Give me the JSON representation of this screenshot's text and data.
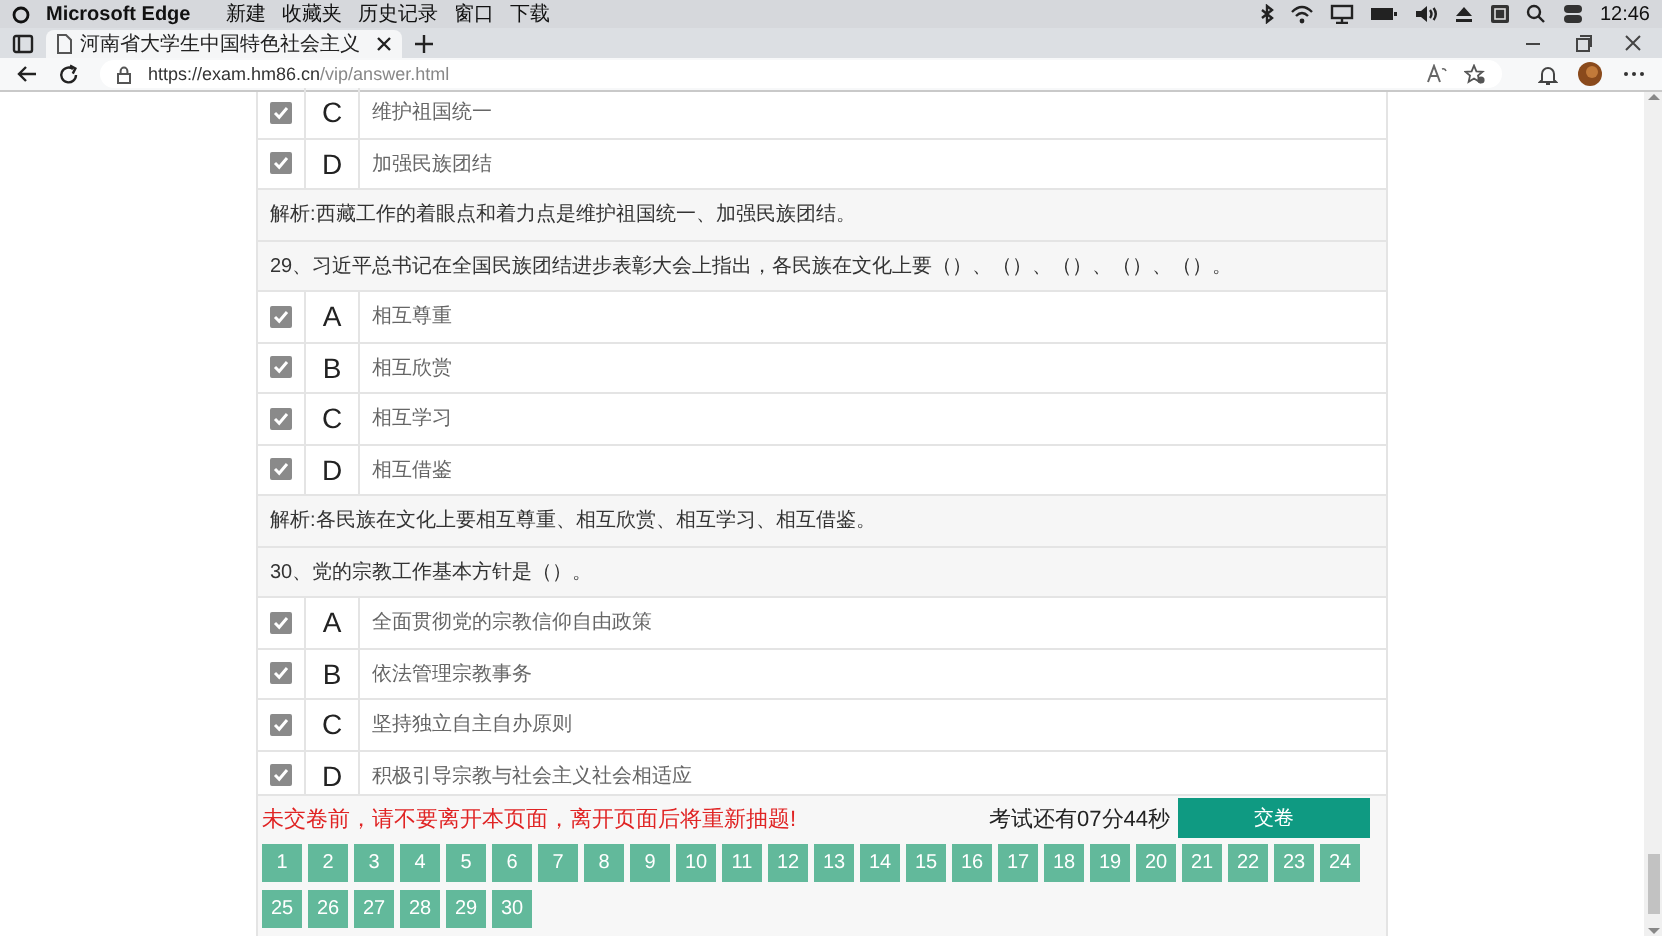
{
  "menu_bar": {
    "app": "Microsoft Edge",
    "items": [
      "新建",
      "收藏夹",
      "历史记录",
      "窗口",
      "下载"
    ],
    "clock": "12:46"
  },
  "tab": {
    "title": "河南省大学生中国特色社会主义"
  },
  "address_bar": {
    "url_host": "https://exam.hm86.cn",
    "url_path": "/vip/answer.html"
  },
  "blocks": [
    {
      "kind": "option",
      "letter": "C",
      "text": "维护祖国统一",
      "checked": true
    },
    {
      "kind": "option",
      "letter": "D",
      "text": "加强民族团结",
      "checked": true
    },
    {
      "kind": "explanation",
      "text": "解析:西藏工作的着眼点和着力点是维护祖国统一、加强民族团结。"
    },
    {
      "kind": "question",
      "text": "29、习近平总书记在全国民族团结进步表彰大会上指出，各民族在文化上要（）、（）、（）、（）、（）。"
    },
    {
      "kind": "option",
      "letter": "A",
      "text": "相互尊重",
      "checked": true
    },
    {
      "kind": "option",
      "letter": "B",
      "text": "相互欣赏",
      "checked": true
    },
    {
      "kind": "option",
      "letter": "C",
      "text": "相互学习",
      "checked": true
    },
    {
      "kind": "option",
      "letter": "D",
      "text": "相互借鉴",
      "checked": true
    },
    {
      "kind": "explanation",
      "text": "解析:各民族在文化上要相互尊重、相互欣赏、相互学习、相互借鉴。"
    },
    {
      "kind": "question",
      "text": "30、党的宗教工作基本方针是（）。"
    },
    {
      "kind": "option",
      "letter": "A",
      "text": "全面贯彻党的宗教信仰自由政策",
      "checked": true
    },
    {
      "kind": "option",
      "letter": "B",
      "text": "依法管理宗教事务",
      "checked": true
    },
    {
      "kind": "option",
      "letter": "C",
      "text": "坚持独立自主自办原则",
      "checked": true
    },
    {
      "kind": "option",
      "letter": "D",
      "text": "积极引导宗教与社会主义社会相适应",
      "checked": true
    }
  ],
  "footer": {
    "warning": "未交卷前，请不要离开本页面，离开页面后将重新抽题!",
    "timer": "考试还有07分44秒",
    "submit": "交卷",
    "question_numbers": [
      "1",
      "2",
      "3",
      "4",
      "5",
      "6",
      "7",
      "8",
      "9",
      "10",
      "11",
      "12",
      "13",
      "14",
      "15",
      "16",
      "17",
      "18",
      "19",
      "20",
      "21",
      "22",
      "23",
      "24",
      "25",
      "26",
      "27",
      "28",
      "29",
      "30"
    ]
  }
}
